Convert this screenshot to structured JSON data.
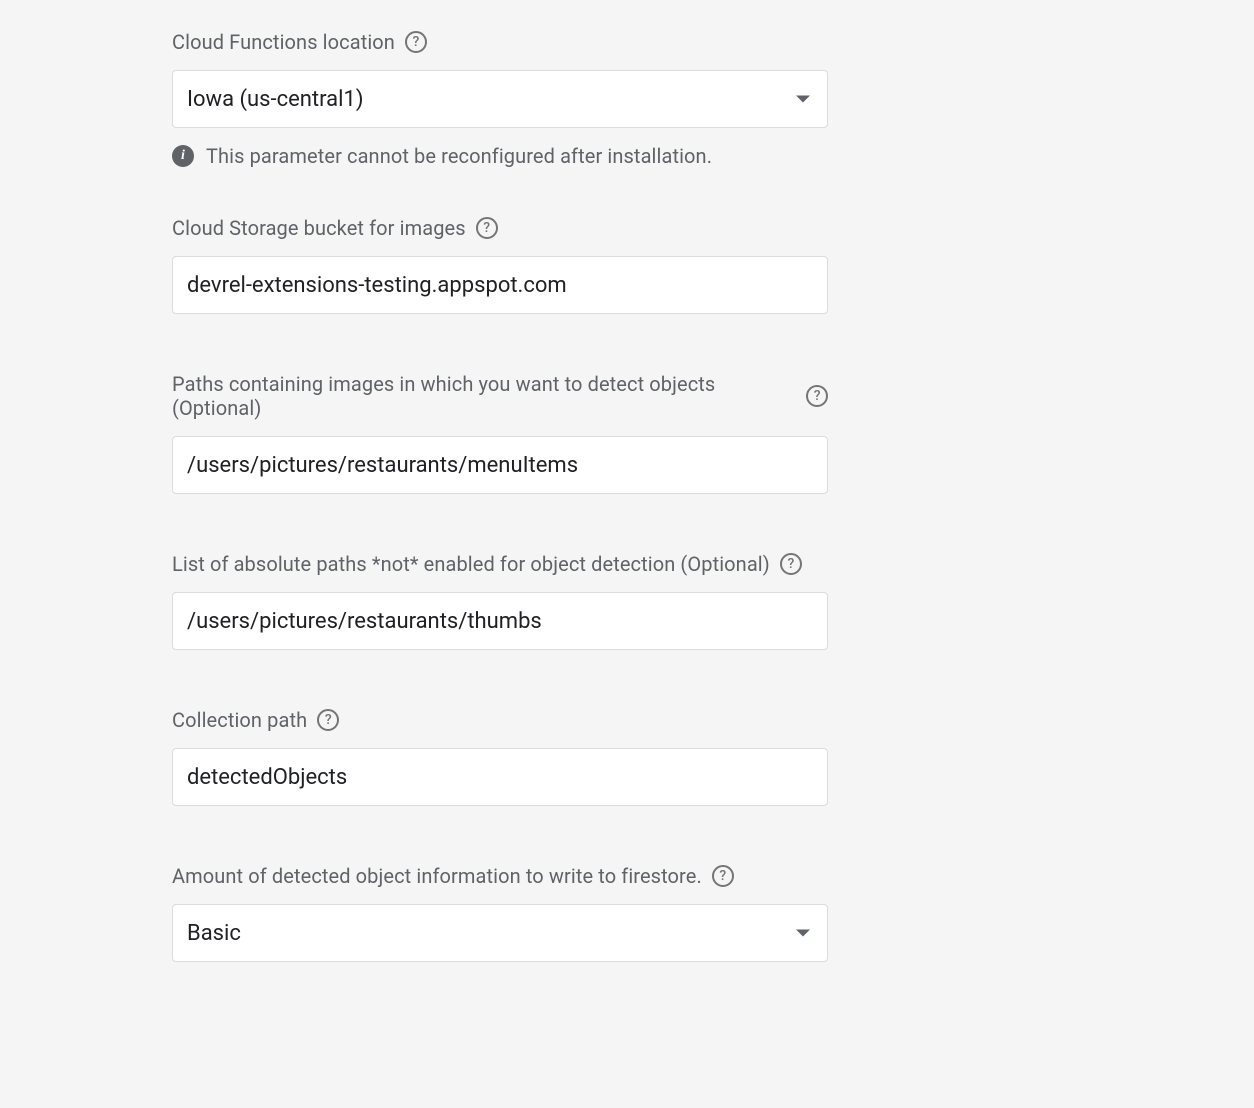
{
  "fields": {
    "location": {
      "label": "Cloud Functions location",
      "value": "Iowa (us-central1)",
      "info": "This parameter cannot be reconfigured after installation."
    },
    "bucket": {
      "label": "Cloud Storage bucket for images",
      "value": "devrel-extensions-testing.appspot.com"
    },
    "includePaths": {
      "label": "Paths containing images in which you want to detect objects (Optional)",
      "value": "/users/pictures/restaurants/menuItems"
    },
    "excludePaths": {
      "label": "List of absolute paths *not* enabled for object detection (Optional)",
      "value": "/users/pictures/restaurants/thumbs"
    },
    "collectionPath": {
      "label": "Collection path",
      "value": "detectedObjects"
    },
    "detailLevel": {
      "label": "Amount of detected object information to write to firestore.",
      "value": "Basic"
    }
  }
}
